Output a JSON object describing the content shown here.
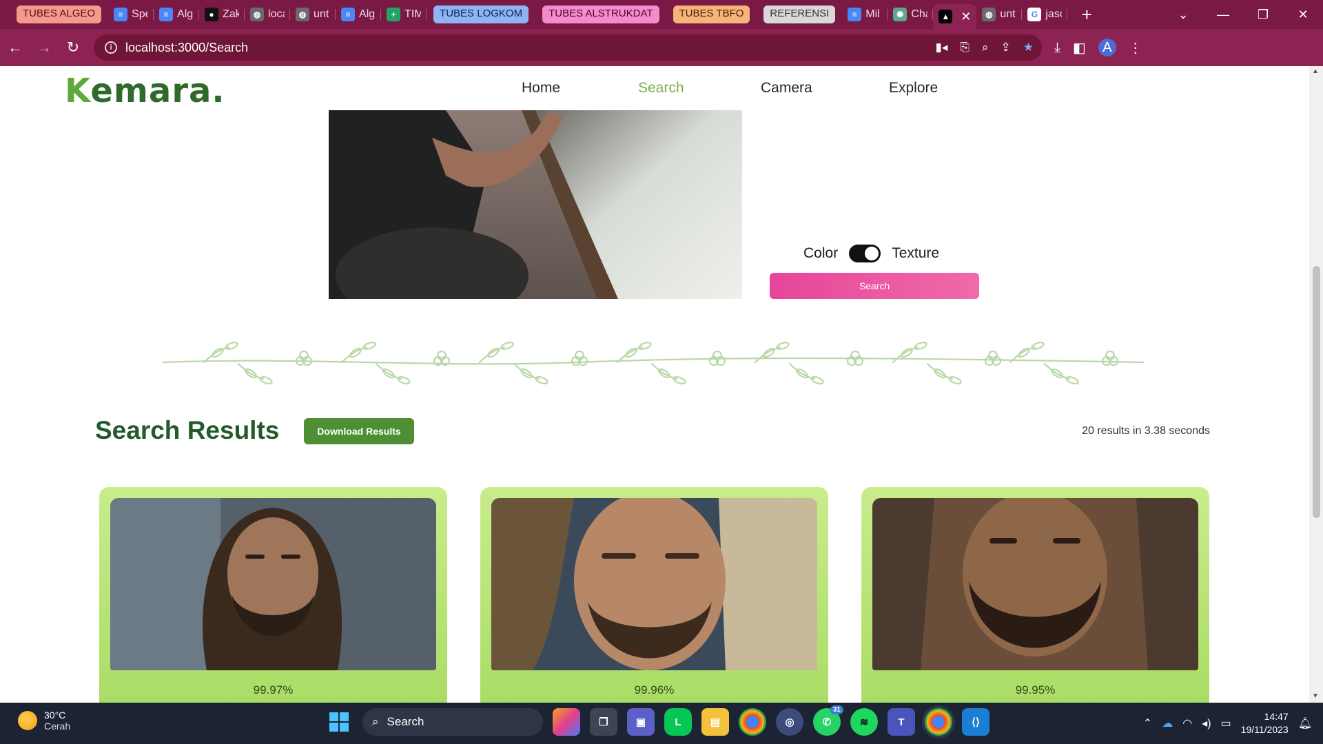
{
  "browser": {
    "tabs": [
      {
        "kind": "group",
        "label": "TUBES ALGEO",
        "bg": "#f39a8c",
        "fg": "#5a1010",
        "line": "#f39a8c"
      },
      {
        "kind": "tab",
        "title": "Spe",
        "icon": "docs-icon",
        "icon_bg": "#4a86f7",
        "glyph": "≡"
      },
      {
        "kind": "tab",
        "title": "Alg",
        "icon": "docs-icon",
        "icon_bg": "#4a86f7",
        "glyph": "≡"
      },
      {
        "kind": "tab",
        "title": "Zak",
        "icon": "github-icon",
        "icon_bg": "#111111",
        "glyph": "●"
      },
      {
        "kind": "tab",
        "title": "loca",
        "icon": "globe-icon",
        "icon_bg": "#6a6a6a",
        "glyph": "◍"
      },
      {
        "kind": "tab",
        "title": "unt",
        "icon": "globe-icon",
        "icon_bg": "#6a6a6a",
        "glyph": "◍"
      },
      {
        "kind": "tab",
        "title": "Alg",
        "icon": "docs-icon",
        "icon_bg": "#4a86f7",
        "glyph": "≡"
      },
      {
        "kind": "tab",
        "title": "TIM",
        "icon": "sheets-icon",
        "icon_bg": "#21a464",
        "glyph": "+"
      },
      {
        "kind": "group",
        "label": "TUBES LOGKOM",
        "bg": "#8fb4f4",
        "fg": "#0c2454",
        "line": "#8fb4f4"
      },
      {
        "kind": "group",
        "label": "TUBES ALSTRUKDAT",
        "bg": "#f58bcc",
        "fg": "#4a0a2c",
        "line": "#f58bcc"
      },
      {
        "kind": "group",
        "label": "TUBES TBFO",
        "bg": "#f7b47a",
        "fg": "#4a2208",
        "line": "#f7b47a"
      },
      {
        "kind": "group",
        "label": "REFERENSI",
        "bg": "#d8d8d8",
        "fg": "#333333",
        "line": "#d8d8d8"
      },
      {
        "kind": "tab",
        "title": "Mil",
        "icon": "docs-icon",
        "icon_bg": "#4a86f7",
        "glyph": "≡"
      },
      {
        "kind": "tab",
        "title": "Cha",
        "icon": "chatgpt-icon",
        "icon_bg": "#5aa88e",
        "glyph": "✺"
      },
      {
        "kind": "tab",
        "title": "",
        "icon": "nextjs-icon",
        "icon_bg": "#000000",
        "glyph": "▲",
        "active": true
      },
      {
        "kind": "tab",
        "title": "unt",
        "icon": "globe-icon",
        "icon_bg": "#6a6a6a",
        "glyph": "◍"
      },
      {
        "kind": "tab",
        "title": "jaso",
        "icon": "google-icon",
        "icon_bg": "#ffffff",
        "glyph": "G"
      }
    ],
    "url": "localhost:3000/Search",
    "profile_initial": "A"
  },
  "site": {
    "logo_k": "K",
    "logo_rest": "emara.",
    "nav": [
      {
        "label": "Home",
        "active": false
      },
      {
        "label": "Search",
        "active": true
      },
      {
        "label": "Camera",
        "active": false
      },
      {
        "label": "Explore",
        "active": false
      }
    ],
    "toggle": {
      "left_label": "Color",
      "right_label": "Texture",
      "state": "Texture"
    },
    "search_button": "Search",
    "results": {
      "title": "Search Results",
      "download_button": "Download Results",
      "count_text": "20 results in 3.38 seconds",
      "items": [
        {
          "similarity": "99.97%"
        },
        {
          "similarity": "99.96%"
        },
        {
          "similarity": "99.95%"
        }
      ]
    }
  },
  "taskbar": {
    "weather": {
      "temp": "30°C",
      "condition": "Cerah"
    },
    "search_placeholder": "Search",
    "teams_badge": "31",
    "time": "14:47",
    "date": "19/11/2023"
  },
  "colors": {
    "browser_frame": "#7a1a44",
    "brand_green": "#2f6a2b",
    "accent_green": "#7cae4a",
    "search_pink": "#e7459a",
    "card_green": "#b8e47a"
  }
}
